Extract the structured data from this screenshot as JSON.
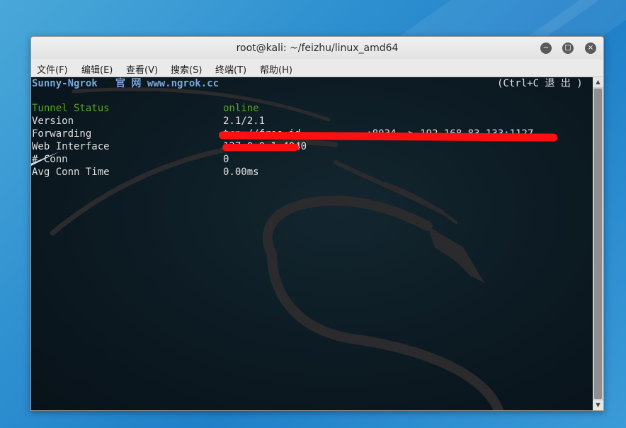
{
  "window": {
    "title": "root@kali: ~/feizhu/linux_amd64"
  },
  "menu": [
    "文件(F)",
    "编辑(E)",
    "查看(V)",
    "搜索(S)",
    "终端(T)",
    "帮助(H)"
  ],
  "terminal": {
    "header_left": "Sunny-Ngrok   官 网 www.ngrok.cc",
    "header_right": "(Ctrl+C 退 出 )",
    "rows": [
      {
        "label": "Tunnel Status",
        "value": "online"
      },
      {
        "label": "Version",
        "value": "2.1/2.1"
      },
      {
        "label": "Forwarding",
        "value": "tcp://free.id...........:8034 -> 192.168.83.133:1127"
      },
      {
        "label": "Web Interface",
        "value": "127.0.0.1:4040"
      },
      {
        "label": "# Conn",
        "value": "0"
      },
      {
        "label": "Avg Conn Time",
        "value": "0.00ms"
      }
    ]
  },
  "colors": {
    "header_text": "#7aa6da",
    "status_text": "#58a62a",
    "redaction": "#ff1010"
  }
}
